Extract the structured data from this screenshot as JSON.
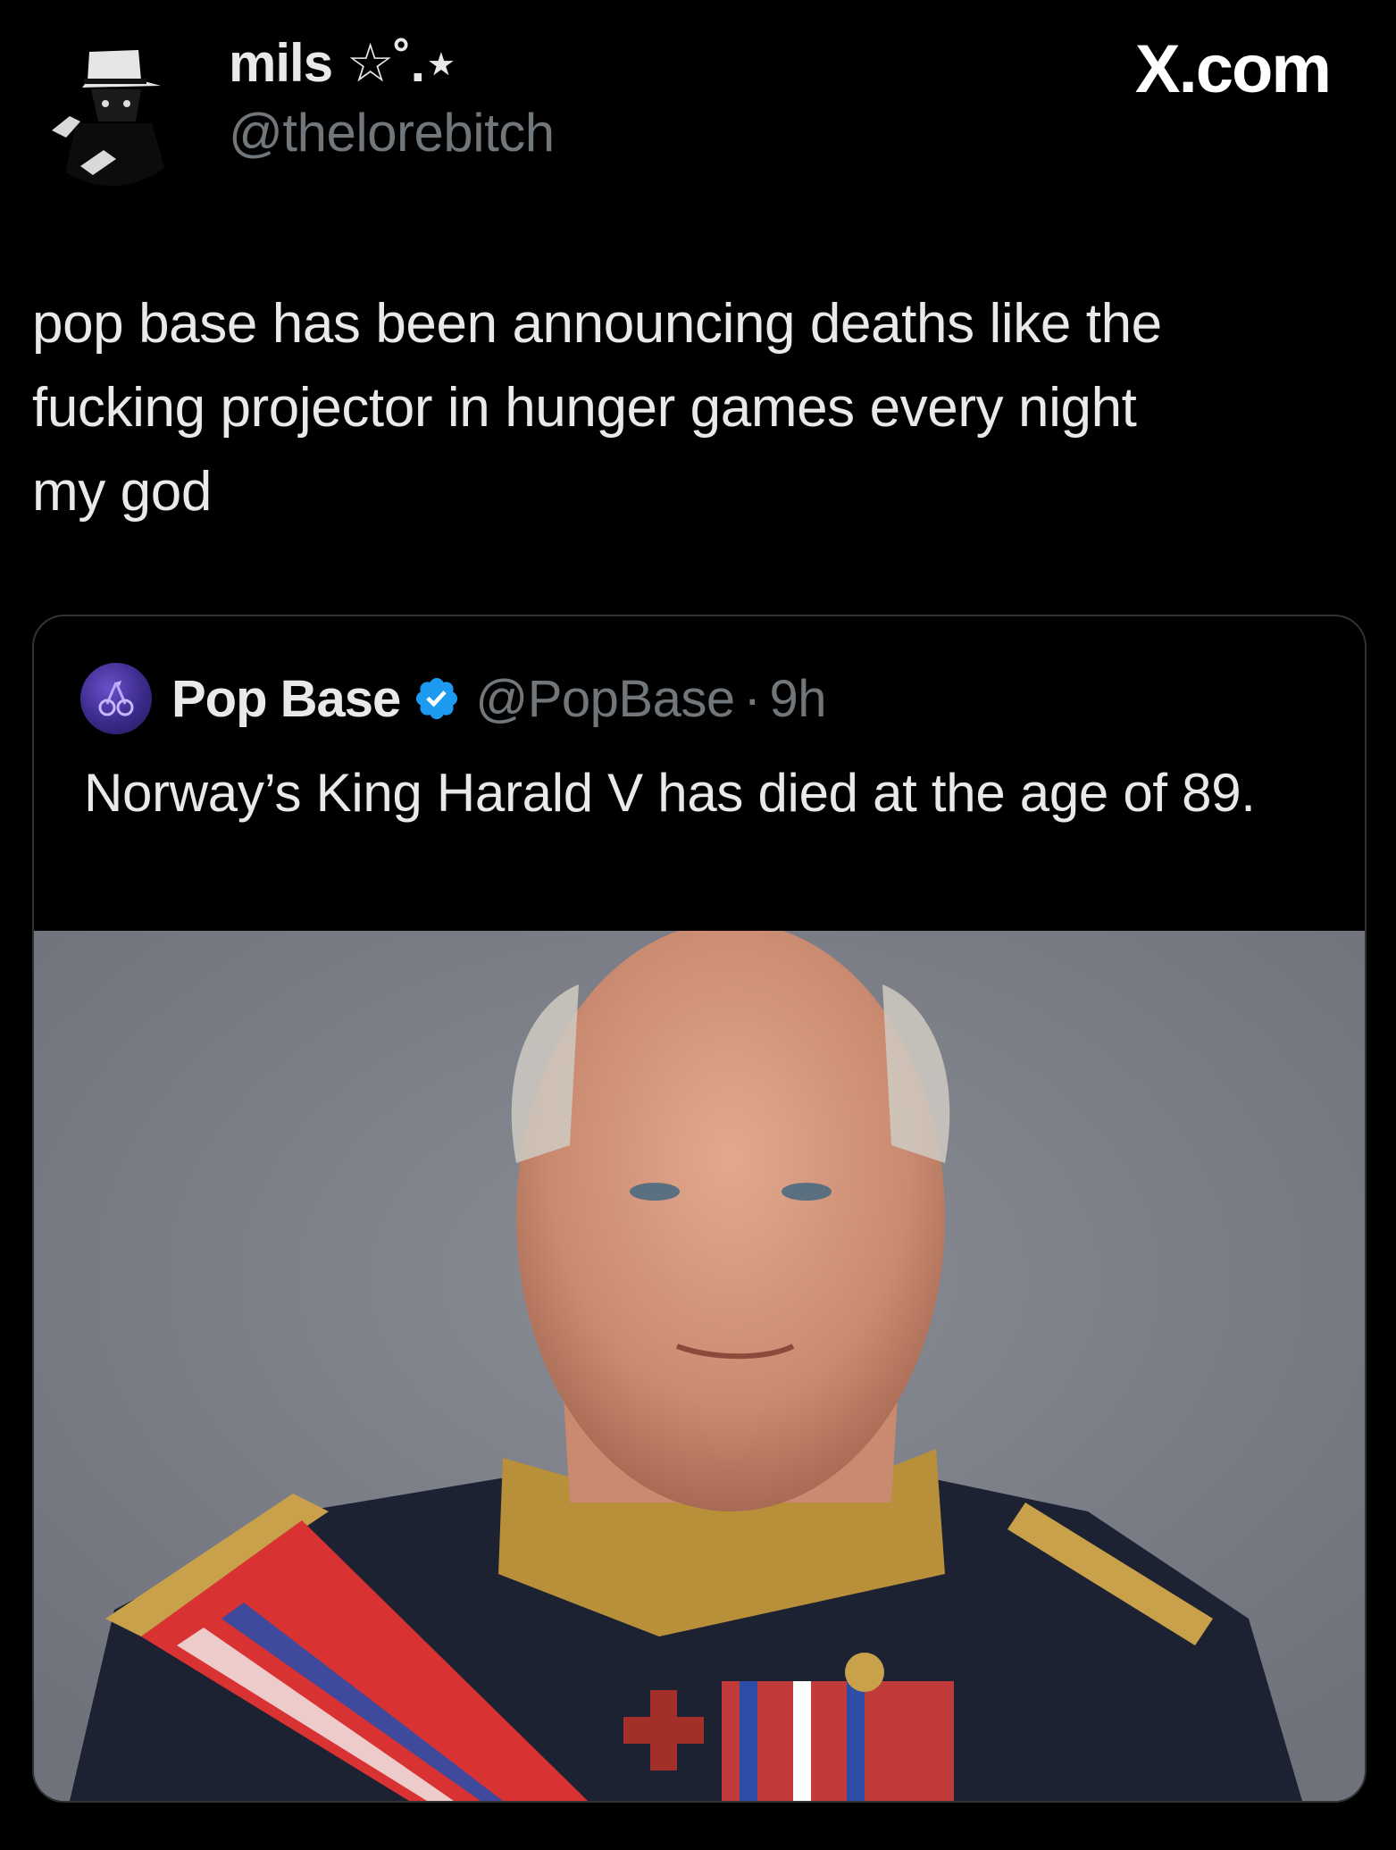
{
  "author": {
    "display_name": "mils ☆˚.⋆",
    "handle": "@thelorebitch",
    "avatar_icon": "hat-figure-avatar-icon"
  },
  "brand": {
    "label": "X.com"
  },
  "tweet": {
    "text": "pop base has been announcing deaths like the\nfucking projector in hunger games every night\nmy god"
  },
  "quote": {
    "avatar_icon": "cherry-logo-avatar-icon",
    "name": "Pop Base",
    "verified_icon": "verified-badge-icon",
    "handle": "@PopBase",
    "separator": "·",
    "time": "9h",
    "text": "Norway’s King Harald V has died at the age of 89.",
    "media_icon": "portrait-photo",
    "colors": {
      "verified": "#1d9bf0",
      "media_background": "#7c7f88"
    }
  },
  "colors": {
    "background": "#000000",
    "primary_text": "#e7e9ea",
    "secondary_text": "#71767b",
    "border": "#2f3336"
  }
}
